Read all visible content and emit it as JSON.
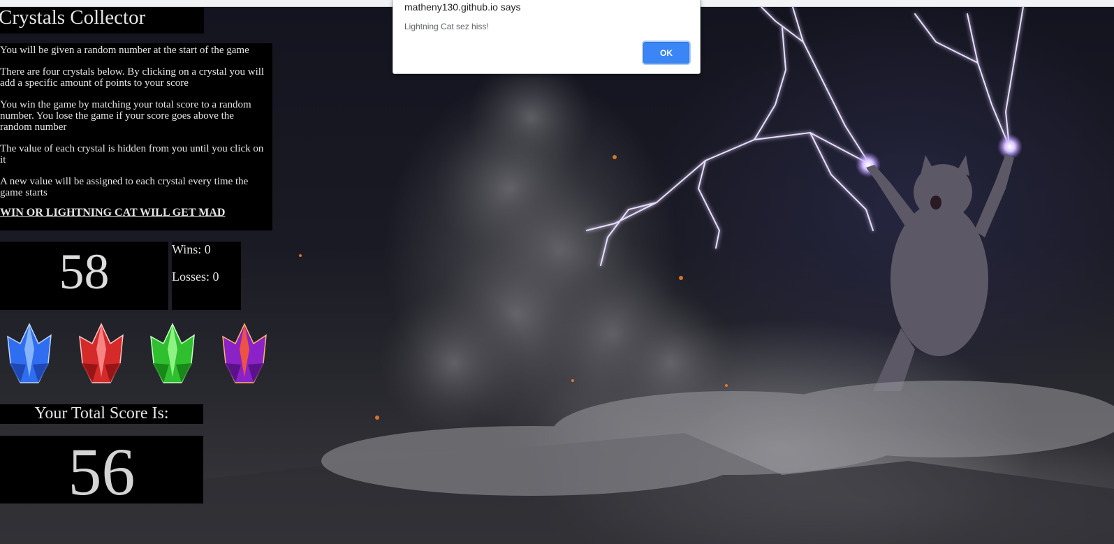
{
  "dialog": {
    "origin": "matheny130.github.io says",
    "message": "Lightning Cat sez hiss!",
    "ok_label": "OK"
  },
  "game": {
    "title": "Crystals Collector",
    "instructions": [
      "You will be given a random number at the start of the game",
      "There are four crystals below. By clicking on a crystal you will add a specific amount of points to your score",
      "You win the game by matching your total score to a random number. You lose the game if your score goes above the random number",
      "The value of each crystal is hidden from you until you click on it",
      "A new value will be assigned to each crystal every time the game starts"
    ],
    "warning": "WIN OR LIGHTNING CAT WILL GET MAD",
    "target_number": "58",
    "wins_text": "Wins: 0",
    "losses_text": "Losses: 0",
    "score_label": "Your Total Score Is:",
    "score_value": "56",
    "crystals": [
      {
        "name": "blue-crystal",
        "color": "#3a7bff"
      },
      {
        "name": "red-crystal",
        "color": "#e23a3a"
      },
      {
        "name": "green-crystal",
        "color": "#3ccf3c"
      },
      {
        "name": "purple-crystal",
        "color": "#9b2fd6"
      }
    ]
  },
  "background": {
    "description_icon": "lightning-cat-volcano-image"
  }
}
